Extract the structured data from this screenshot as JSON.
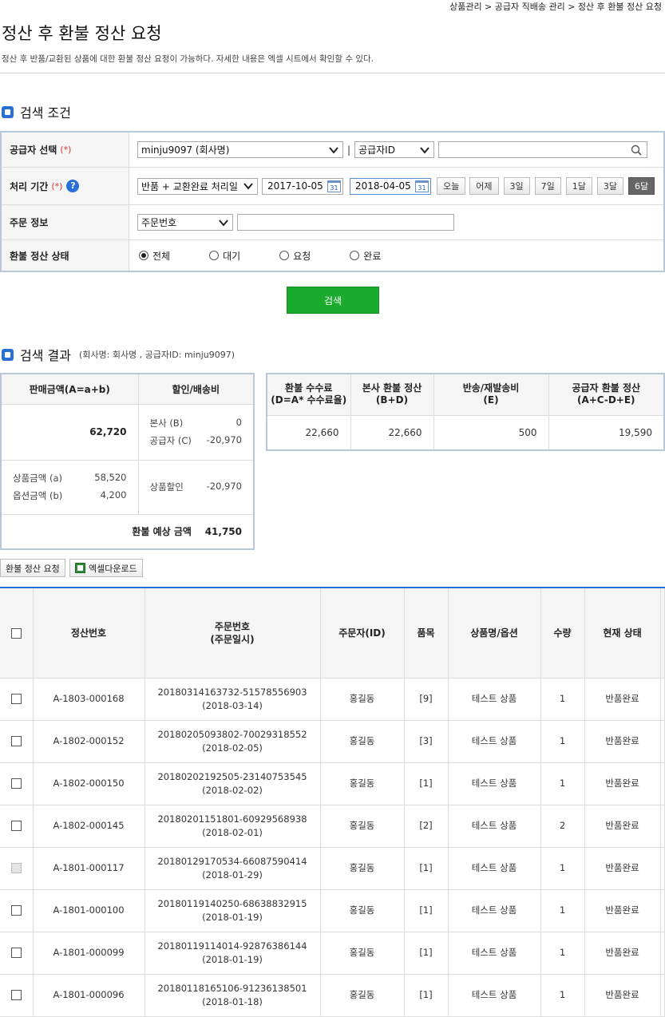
{
  "breadcrumb": "상품관리 > 공급자 직배송 관리 > 정산 후 환불 정산 요청",
  "page": {
    "title": "정산 후 환불 정산 요청",
    "desc": "정산 후 반품/교환된 상품에 대한 환불 정산 요청이 가능하다. 자세한 내용은 엑셀 시트에서 확인할 수 있다."
  },
  "search": {
    "title": "검색 조건",
    "supplier_label": "공급자 선택",
    "required_mark": "(*)",
    "supplier_select": "minju9097 (회사명)",
    "separator": "|",
    "id_select": "공급자ID",
    "period_label": "처리 기간",
    "help": "?",
    "period_type": "반품 + 교환완료 처리일",
    "date_from": "2017-10-05",
    "date_to": "2018-04-05",
    "cal": "31",
    "quick": [
      "오늘",
      "어제",
      "3일",
      "7일",
      "1달",
      "3달",
      "6달"
    ],
    "order_label": "주문 정보",
    "order_select": "주문번호",
    "status_label": "환불 정산 상태",
    "statuses": [
      "전체",
      "대기",
      "요청",
      "완료"
    ],
    "button": "검색"
  },
  "result": {
    "title": "검색 결과",
    "sub": "(회사명: 회사명 , 공급자ID: minju9097)",
    "sum1": {
      "h_sales": "판매금액(A=a+b)",
      "h_disc": "할인/배송비",
      "total_sales": "62,720",
      "hq_label": "본사 (B)",
      "hq_value": "0",
      "sup_label": "공급자 (C)",
      "sup_value": "-20,970",
      "prod_label": "상품금액 (a)",
      "prod_value": "58,520",
      "opt_label": "옵션금액 (b)",
      "opt_value": "4,200",
      "pdisc_label": "상품할인",
      "pdisc_value": "-20,970",
      "expect_label": "환불 예상 금액",
      "expect_value": "41,750"
    },
    "sum2": {
      "headers": [
        [
          "환불 수수료",
          "(D=A* 수수료율)"
        ],
        [
          "본사 환불 정산",
          "(B+D)"
        ],
        [
          "반송/재발송비",
          "(E)"
        ],
        [
          "공급자 환불 정산",
          "(A+C-D+E)"
        ]
      ],
      "values": [
        "22,660",
        "22,660",
        "500",
        "19,590"
      ]
    },
    "btn_refund": "환불 정산 요청",
    "btn_excel": "엑셀다운로드"
  },
  "grid": {
    "headers": [
      "정산번호",
      "주문번호",
      "(주문일시)",
      "주문자(ID)",
      "품목",
      "상품명/옵션",
      "수량",
      "현재 상태"
    ],
    "rows": [
      {
        "no": "A-1803-000168",
        "order": "20180314163732-51578556903",
        "date": "(2018-03-14)",
        "user": "홍길동",
        "items": "[9]",
        "product": "테스트 상품",
        "qty": "1",
        "status": "반품완료",
        "disabled": false
      },
      {
        "no": "A-1802-000152",
        "order": "20180205093802-70029318552",
        "date": "(2018-02-05)",
        "user": "홍길동",
        "items": "[3]",
        "product": "테스트 상품",
        "qty": "1",
        "status": "반품완료",
        "disabled": false
      },
      {
        "no": "A-1802-000150",
        "order": "20180202192505-23140753545",
        "date": "(2018-02-02)",
        "user": "홍길동",
        "items": "[1]",
        "product": "테스트 상품",
        "qty": "1",
        "status": "반품완료",
        "disabled": false
      },
      {
        "no": "A-1802-000145",
        "order": "20180201151801-60929568938",
        "date": "(2018-02-01)",
        "user": "홍길동",
        "items": "[2]",
        "product": "테스트 상품",
        "qty": "2",
        "status": "반품완료",
        "disabled": false
      },
      {
        "no": "A-1801-000117",
        "order": "20180129170534-66087590414",
        "date": "(2018-01-29)",
        "user": "홍길동",
        "items": "[1]",
        "product": "테스트 상품",
        "qty": "1",
        "status": "반품완료",
        "disabled": true
      },
      {
        "no": "A-1801-000100",
        "order": "20180119140250-68638832915",
        "date": "(2018-01-19)",
        "user": "홍길동",
        "items": "[1]",
        "product": "테스트 상품",
        "qty": "1",
        "status": "반품완료",
        "disabled": false
      },
      {
        "no": "A-1801-000099",
        "order": "20180119114014-92876386144",
        "date": "(2018-01-19)",
        "user": "홍길동",
        "items": "[1]",
        "product": "테스트 상품",
        "qty": "1",
        "status": "반품완료",
        "disabled": false
      },
      {
        "no": "A-1801-000096",
        "order": "20180118165106-91236138501",
        "date": "(2018-01-18)",
        "user": "홍길동",
        "items": "[1]",
        "product": "테스트 상품",
        "qty": "1",
        "status": "반품완료",
        "disabled": false
      }
    ]
  }
}
